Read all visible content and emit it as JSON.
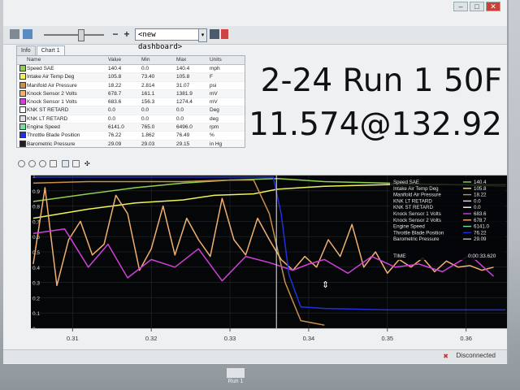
{
  "toolbar": {
    "zoom_out_label": "−",
    "zoom_in_label": "+",
    "dashboard_select": "<new dashboard>",
    "dashboard_arrow": "▾"
  },
  "window_controls": {
    "minimize": "–",
    "maximize": "□",
    "close": "✕"
  },
  "tabs": [
    {
      "label": "Info"
    },
    {
      "label": "Chart 1"
    }
  ],
  "grid": {
    "headers": {
      "name": "Name",
      "value": "Value",
      "min": "Min",
      "max": "Max",
      "units": "Units"
    },
    "rows": [
      {
        "name": "Speed SAE",
        "value": "140.4",
        "min": "0.0",
        "max": "140.4",
        "units": "mph",
        "color": "#8fd14f"
      },
      {
        "name": "Intake Air Temp Deg",
        "value": "105.8",
        "min": "73.40",
        "max": "105.8",
        "units": "F",
        "color": "#f2f25a"
      },
      {
        "name": "Manifold Air Pressure",
        "value": "18.22",
        "min": "2.814",
        "max": "31.07",
        "units": "psi",
        "color": "#c8904a"
      },
      {
        "name": "Knock Sensor 2 Volts",
        "value": "678.7",
        "min": "161.1",
        "max": "1381.9",
        "units": "mV",
        "color": "#f0b070"
      },
      {
        "name": "Knock Sensor 1 Volts",
        "value": "683.6",
        "min": "156.3",
        "max": "1274.4",
        "units": "mV",
        "color": "#d040d8"
      },
      {
        "name": "KNK ST RETARD",
        "value": "0.0",
        "min": "0.0",
        "max": "0.0",
        "units": "Deg",
        "color": "#ffffff"
      },
      {
        "name": "KNK LT RETARD",
        "value": "0.0",
        "min": "0.0",
        "max": "0.0",
        "units": "deg",
        "color": "#e0e0e0"
      },
      {
        "name": "Engine Speed",
        "value": "6141.0",
        "min": "765.0",
        "max": "6496.0",
        "units": "rpm",
        "color": "#70e0a0"
      },
      {
        "name": "Throttle Blade Position",
        "value": "76.22",
        "min": "1.862",
        "max": "76.49",
        "units": "%",
        "color": "#2030e0"
      },
      {
        "name": "Barometric Pressure",
        "value": "29.09",
        "min": "29.03",
        "max": "29.15",
        "units": "in Hg",
        "color": "#202020"
      }
    ]
  },
  "overlay": {
    "line1": "2-24 Run 1 50F",
    "line2": "11.574@132.92"
  },
  "chart_data": {
    "type": "line",
    "x_ticks": [
      "0.31",
      "0.32",
      "0.33",
      "0.34",
      "0.35",
      "0.36"
    ],
    "y_ticks": [
      "1",
      "0.9",
      "0.8",
      "0.7",
      "0.6",
      "0.5",
      "0.4",
      "0.3",
      "0.2",
      "0.1",
      "0"
    ],
    "xlim": [
      0.3047,
      0.3652
    ],
    "ylim": [
      0,
      1
    ],
    "cursor_x": 0.3359,
    "legend": {
      "rows": [
        {
          "name": "Speed SAE",
          "value": "140.4"
        },
        {
          "name": "Intake Air Temp Deg",
          "value": "105.8"
        },
        {
          "name": "Manifold Air Pressure",
          "value": "18.22"
        },
        {
          "name": "KNK LT RETARD",
          "value": "0.0"
        },
        {
          "name": "KNK ST RETARD",
          "value": "0.0"
        },
        {
          "name": "Knock Sensor 1 Volts",
          "value": "683.6"
        },
        {
          "name": "Knock Sensor 2 Volts",
          "value": "678.7"
        },
        {
          "name": "Engine Speed",
          "value": "6141.0"
        },
        {
          "name": "Throttle Blade Position",
          "value": "76.22"
        },
        {
          "name": "Barometric Pressure",
          "value": "29.09"
        }
      ],
      "time_label": "TIME",
      "time_value": "0:00:33.620"
    },
    "series": [
      {
        "color": "#8fd14f",
        "x": [
          0.305,
          0.312,
          0.318,
          0.324,
          0.33,
          0.336,
          0.342,
          0.35,
          0.358,
          0.365
        ],
        "y": [
          0.83,
          0.88,
          0.92,
          0.95,
          0.97,
          0.98,
          0.96,
          0.95,
          0.94,
          0.93
        ]
      },
      {
        "color": "#f2f25a",
        "x": [
          0.305,
          0.312,
          0.318,
          0.324,
          0.328,
          0.333,
          0.336,
          0.342,
          0.35,
          0.358,
          0.365
        ],
        "y": [
          0.72,
          0.78,
          0.82,
          0.84,
          0.87,
          0.88,
          0.91,
          0.93,
          0.94,
          0.94,
          0.94
        ]
      },
      {
        "color": "#c8904a",
        "x": [
          0.305,
          0.312,
          0.318,
          0.324,
          0.33,
          0.333,
          0.335,
          0.337,
          0.339,
          0.342
        ],
        "y": [
          0.95,
          0.96,
          0.96,
          0.96,
          0.97,
          0.97,
          0.75,
          0.3,
          0.05,
          0.02
        ]
      },
      {
        "color": "#f0b070",
        "x": [
          0.305,
          0.3065,
          0.308,
          0.3095,
          0.311,
          0.3125,
          0.314,
          0.3155,
          0.317,
          0.3185,
          0.32,
          0.3215,
          0.323,
          0.3245,
          0.326,
          0.3275,
          0.329,
          0.3305,
          0.332,
          0.3335,
          0.335,
          0.3365,
          0.338,
          0.3395,
          0.341,
          0.3425,
          0.344,
          0.3455,
          0.347,
          0.3485,
          0.35,
          0.3515,
          0.353,
          0.3545,
          0.356,
          0.3575,
          0.359,
          0.3605,
          0.362,
          0.3635
        ],
        "y": [
          0.42,
          0.92,
          0.28,
          0.58,
          0.7,
          0.48,
          0.55,
          0.87,
          0.75,
          0.38,
          0.52,
          0.8,
          0.48,
          0.72,
          0.58,
          0.47,
          0.85,
          0.58,
          0.48,
          0.72,
          0.58,
          0.45,
          0.38,
          0.47,
          0.4,
          0.58,
          0.47,
          0.68,
          0.4,
          0.5,
          0.36,
          0.45,
          0.4,
          0.46,
          0.37,
          0.44,
          0.4,
          0.41,
          0.38,
          0.4
        ]
      },
      {
        "color": "#d040d8",
        "x": [
          0.305,
          0.309,
          0.312,
          0.3145,
          0.317,
          0.32,
          0.323,
          0.326,
          0.329,
          0.332,
          0.335,
          0.338,
          0.34,
          0.342,
          0.345,
          0.348,
          0.351,
          0.354,
          0.357,
          0.3605,
          0.3635
        ],
        "y": [
          0.62,
          0.65,
          0.4,
          0.55,
          0.33,
          0.45,
          0.4,
          0.52,
          0.31,
          0.47,
          0.43,
          0.38,
          0.42,
          0.45,
          0.36,
          0.47,
          0.4,
          0.42,
          0.37,
          0.48,
          0.34
        ]
      },
      {
        "color": "#2030e0",
        "x": [
          0.305,
          0.312,
          0.318,
          0.324,
          0.33,
          0.3355,
          0.3365,
          0.3375,
          0.339,
          0.342,
          0.35,
          0.358,
          0.365
        ],
        "y": [
          0.99,
          0.99,
          0.99,
          0.99,
          0.99,
          0.99,
          0.75,
          0.35,
          0.14,
          0.13,
          0.12,
          0.12,
          0.12
        ]
      }
    ]
  }
}
